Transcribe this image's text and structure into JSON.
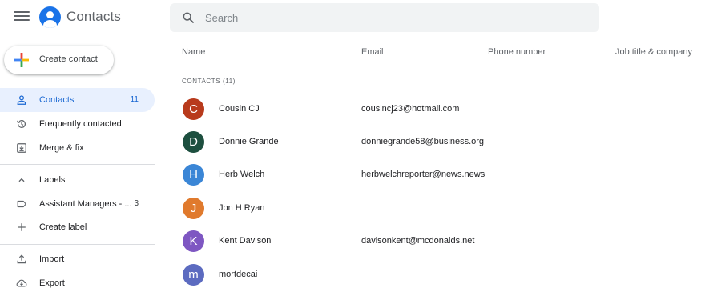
{
  "app": {
    "title": "Contacts"
  },
  "search": {
    "placeholder": "Search"
  },
  "create_button": {
    "label": "Create contact"
  },
  "sidebar": {
    "contacts": {
      "label": "Contacts",
      "count": "11"
    },
    "frequently_contacted": {
      "label": "Frequently contacted"
    },
    "merge_fix": {
      "label": "Merge & fix"
    },
    "labels": {
      "label": "Labels"
    },
    "assistant_managers": {
      "label": "Assistant Managers - ...",
      "count": "3"
    },
    "create_label": {
      "label": "Create label"
    },
    "import": {
      "label": "Import"
    },
    "export": {
      "label": "Export"
    }
  },
  "table": {
    "columns": [
      "Name",
      "Email",
      "Phone number",
      "Job title & company"
    ],
    "section_label": "CONTACTS (11)",
    "rows": [
      {
        "initial": "C",
        "name": "Cousin CJ",
        "email": "cousincj23@hotmail.com",
        "color": "#b83a1c"
      },
      {
        "initial": "D",
        "name": "Donnie Grande",
        "email": "donniegrande58@business.org",
        "color": "#1d4f3f"
      },
      {
        "initial": "H",
        "name": "Herb Welch",
        "email": "herbwelchreporter@news.news",
        "color": "#3b86d6"
      },
      {
        "initial": "J",
        "name": "Jon H Ryan",
        "email": "",
        "color": "#e07a2d"
      },
      {
        "initial": "K",
        "name": "Kent Davison",
        "email": "davisonkent@mcdonalds.net",
        "color": "#7e57c2"
      },
      {
        "initial": "m",
        "name": "mortdecai",
        "email": "",
        "color": "#5c6bc0"
      }
    ]
  },
  "colors": {
    "accent": "#1a73e8",
    "active_bg": "#e8f0fe"
  }
}
